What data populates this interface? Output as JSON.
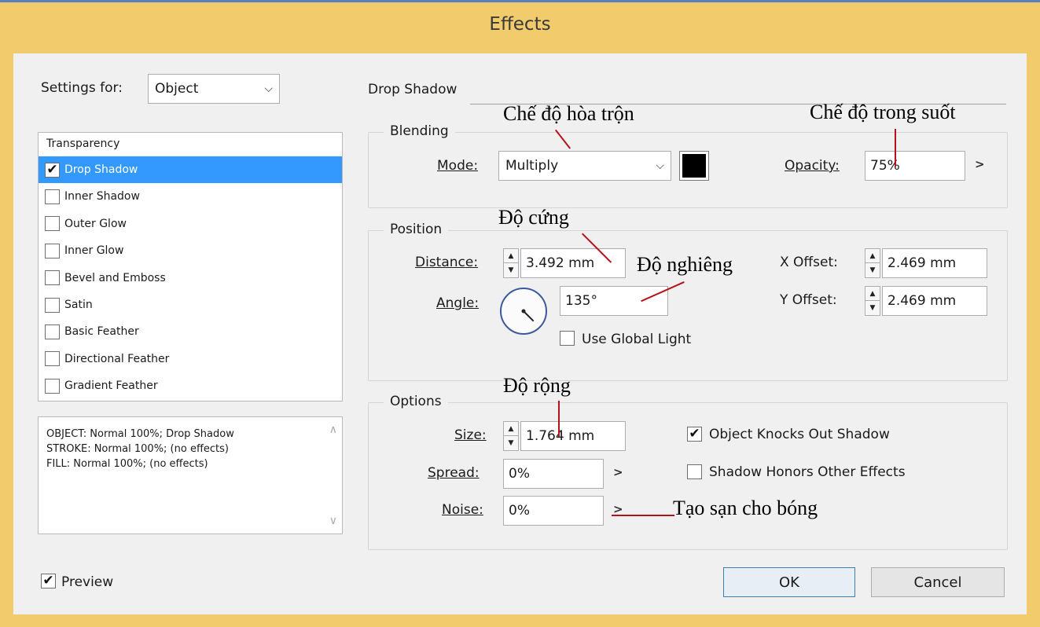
{
  "window": {
    "title": "Effects"
  },
  "settings_for": {
    "label": "Settings for:",
    "value": "Object"
  },
  "effects_list": {
    "header": "Transparency",
    "items": [
      {
        "label": "Drop Shadow",
        "checked": true,
        "selected": true
      },
      {
        "label": "Inner Shadow",
        "checked": false,
        "selected": false
      },
      {
        "label": "Outer Glow",
        "checked": false,
        "selected": false
      },
      {
        "label": "Inner Glow",
        "checked": false,
        "selected": false
      },
      {
        "label": "Bevel and Emboss",
        "checked": false,
        "selected": false
      },
      {
        "label": "Satin",
        "checked": false,
        "selected": false
      },
      {
        "label": "Basic Feather",
        "checked": false,
        "selected": false
      },
      {
        "label": "Directional Feather",
        "checked": false,
        "selected": false
      },
      {
        "label": "Gradient Feather",
        "checked": false,
        "selected": false
      }
    ]
  },
  "summary": [
    "OBJECT: Normal 100%; Drop Shadow",
    "STROKE: Normal 100%; (no effects)",
    "FILL: Normal 100%; (no effects)"
  ],
  "panel": {
    "title": "Drop Shadow"
  },
  "blending": {
    "title": "Blending",
    "mode_label": "Mode:",
    "mode_value": "Multiply",
    "swatch_color": "#000000",
    "opacity_label": "Opacity:",
    "opacity_value": "75%"
  },
  "position": {
    "title": "Position",
    "distance_label": "Distance:",
    "distance_value": "3.492 mm",
    "angle_label": "Angle:",
    "angle_value": "135°",
    "angle_degrees": 135,
    "use_global_light_label": "Use Global Light",
    "use_global_light": false,
    "x_offset_label": "X Offset:",
    "x_offset_value": "2.469 mm",
    "y_offset_label": "Y Offset:",
    "y_offset_value": "2.469 mm"
  },
  "options": {
    "title": "Options",
    "size_label": "Size:",
    "size_value": "1.764 mm",
    "spread_label": "Spread:",
    "spread_value": "0%",
    "noise_label": "Noise:",
    "noise_value": "0%",
    "knocks_out_label": "Object Knocks Out Shadow",
    "knocks_out": true,
    "honors_label": "Shadow Honors Other Effects",
    "honors": false
  },
  "preview": {
    "label": "Preview",
    "checked": true
  },
  "buttons": {
    "ok": "OK",
    "cancel": "Cancel"
  },
  "annotations": {
    "blend_mode": "Chế độ hòa trộn",
    "opacity": "Chế độ trong suốt",
    "distance": "Độ cứng",
    "angle": "Độ nghiêng",
    "size": "Độ rộng",
    "noise": "Tạo sạn cho bóng"
  },
  "colors": {
    "frame": "#f1cb6c",
    "selection": "#3399ff",
    "annotation_line": "#b5121b"
  }
}
